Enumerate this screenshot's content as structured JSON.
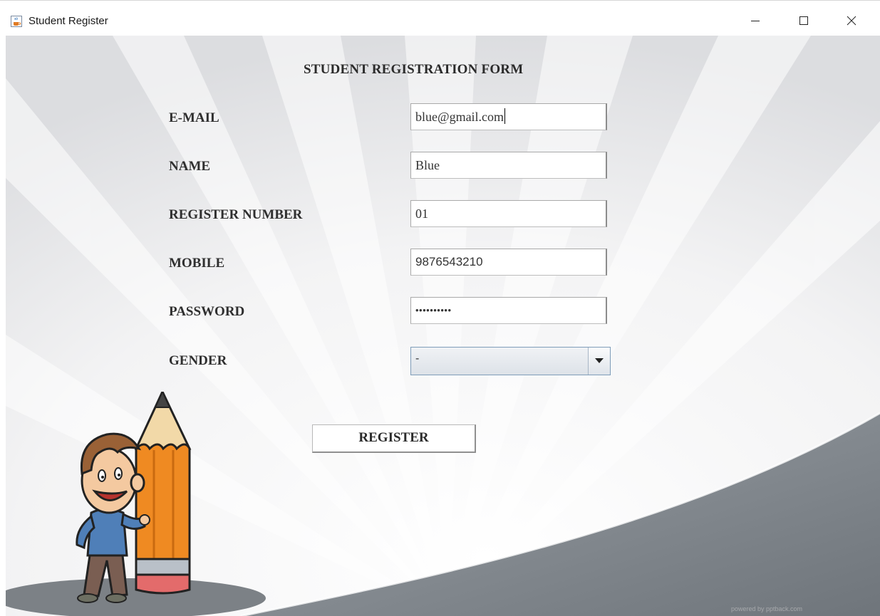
{
  "window": {
    "title": "Student Register",
    "icon": "java-cup-icon",
    "controls": [
      "minimize-icon",
      "maximize-icon",
      "close-icon"
    ]
  },
  "form": {
    "title": "STUDENT REGISTRATION FORM",
    "fields": {
      "email": {
        "label": "E-MAIL",
        "value": "blue@gmail.com"
      },
      "name": {
        "label": "NAME",
        "value": "Blue"
      },
      "register_number": {
        "label": "REGISTER NUMBER",
        "value": "01"
      },
      "mobile": {
        "label": "MOBILE",
        "value": "9876543210"
      },
      "password": {
        "label": "PASSWORD",
        "value": "••••••••••"
      },
      "gender": {
        "label": "GENDER",
        "value": "-"
      }
    },
    "register_button": "REGISTER"
  },
  "watermark": "powered by pptback.com"
}
